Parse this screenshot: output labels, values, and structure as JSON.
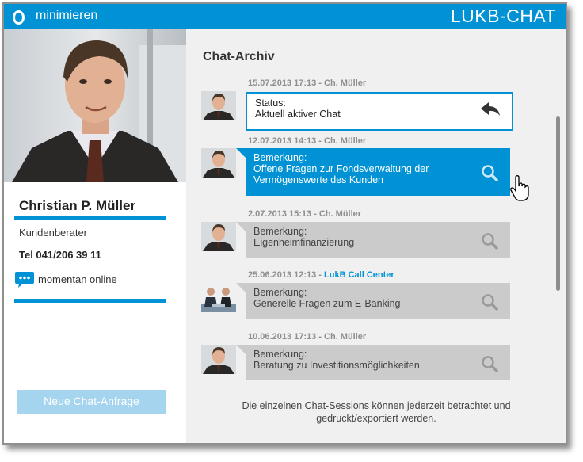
{
  "header": {
    "minimize_label": "minimieren",
    "brand_bold": "LUKB",
    "brand_rest": "-CHAT",
    "color": "#0092d4"
  },
  "agent": {
    "name": "Christian P. Müller",
    "role": "Kundenberater",
    "tel": "Tel 041/206 39 11",
    "status": "momentan online",
    "new_chat_label": "Neue Chat-Anfrage"
  },
  "archive": {
    "title": "Chat-Archiv",
    "entries": [
      {
        "date": "15.07.2013 17:13 - Ch. Müller",
        "agent": "",
        "label": "Status:",
        "text": "Aktuell aktiver Chat",
        "state": "status",
        "icon": "reply-arrow-icon"
      },
      {
        "date": "12.07.2013 14:13 - Ch. Müller",
        "agent": "",
        "label": "Bemerkung:",
        "text": "Offene Fragen zur Fondsverwaltung der Vermögenswerte des Kunden",
        "state": "active",
        "icon": "search-icon"
      },
      {
        "date": "2.07.2013 15:13 - Ch. Müller",
        "agent": "",
        "label": "Bemerkung:",
        "text": "Eigenheimfinanzierung",
        "state": "grey",
        "icon": "search-icon"
      },
      {
        "date": "25.06.2013 12:13 - ",
        "agent": "LukB Call Center",
        "label": "Bemerkung:",
        "text": "Generelle Fragen zum E-Banking",
        "state": "grey",
        "icon": "search-icon"
      },
      {
        "date": "10.06.2013 17:13 - Ch. Müller",
        "agent": "",
        "label": "Bemerkung:",
        "text": "Beratung zu Investitionsmöglichkeiten",
        "state": "grey",
        "icon": "search-icon"
      }
    ],
    "footer": "Die einzelnen Chat-Sessions können jederzeit betrachtet und gedruckt/exportiert werden."
  }
}
